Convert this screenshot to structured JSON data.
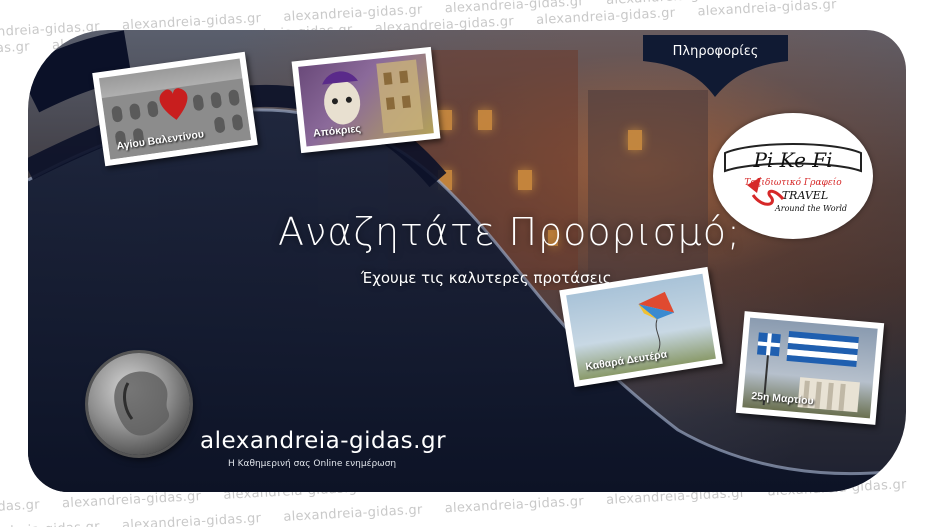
{
  "watermark": {
    "text": "alexandreia-gidas.gr"
  },
  "banner": {
    "title": "Αναζητάτε Προορισμό;",
    "subtitle": "Έχουμε τις καλυτερες προτάσεις",
    "info_tab": "Πληροφορίες",
    "site_url": "alexandreia-gidas.gr",
    "site_tagline": "Η Καθημερινή σας Online ενημέρωση"
  },
  "logo": {
    "name": "Pi Ke Fi",
    "line1": "Ταξιδιωτικό Γραφείο",
    "line2": "TRAVEL",
    "line3": "Around the World"
  },
  "photos": [
    {
      "caption": "Αγίου Βαλεντίνου"
    },
    {
      "caption": "Απόκριες"
    },
    {
      "caption": "Καθαρά Δευτέρα"
    },
    {
      "caption": "25η Μαρτίου"
    }
  ],
  "colors": {
    "logo_red": "#d62828",
    "tab_navy": "#101a33",
    "wave_navy": "#0f1830"
  }
}
